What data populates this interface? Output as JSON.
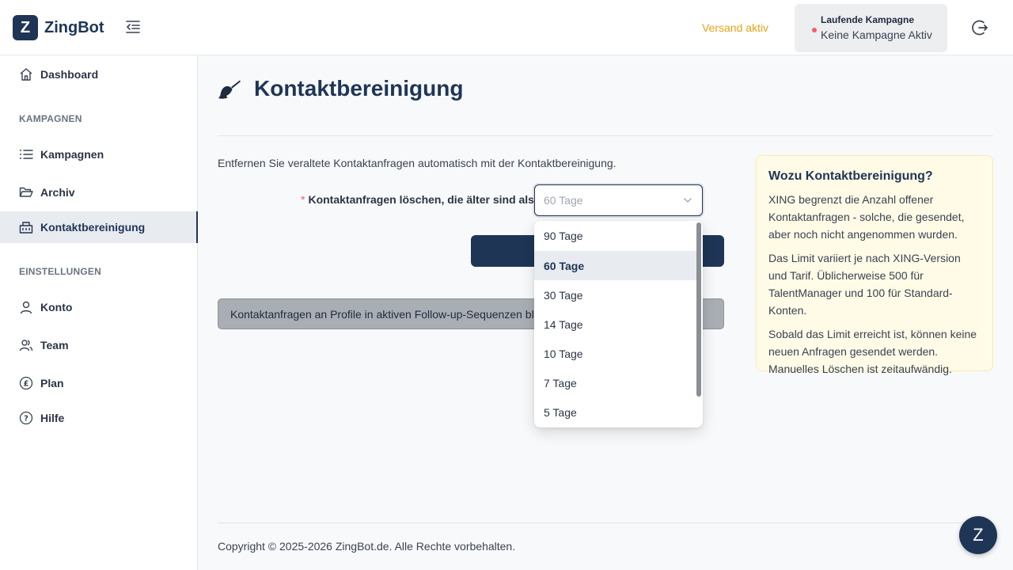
{
  "header": {
    "logo_letter": "Z",
    "app_name": "ZingBot",
    "versand_status": "Versand aktiv",
    "campaign_label": "Laufende Kampagne",
    "campaign_value": "Keine Kampagne Aktiv",
    "accent_color": "#e6a417",
    "status_dot_color": "#f45c6b"
  },
  "sidebar": {
    "dashboard": "Dashboard",
    "section_campaigns": "KAMPAGNEN",
    "kampagnen": "Kampagnen",
    "archiv": "Archiv",
    "kontaktbereinigung": "Kontaktbereinigung",
    "section_settings": "EINSTELLUNGEN",
    "konto": "Konto",
    "team": "Team",
    "plan": "Plan",
    "hilfe": "Hilfe",
    "active_item": "Kontaktbereinigung"
  },
  "main": {
    "title": "Kontaktbereinigung",
    "title_icon": "broom-icon",
    "intro": "Entfernen Sie veraltete Kontaktanfragen automatisch mit der Kontaktbereinigung.",
    "form_required_mark": "*",
    "form_label": "Kontaktanfragen löschen, die älter sind als :",
    "select_value": "60 Tage",
    "gray_bar_text": "Kontaktanfragen an Profile in aktiven Follow-up-Sequenzen bleiben erhalten"
  },
  "dropdown": {
    "options": [
      "90 Tage",
      "60 Tage",
      "30 Tage",
      "14 Tage",
      "10 Tage",
      "7 Tage",
      "5 Tage"
    ],
    "selected": "60 Tage"
  },
  "info": {
    "title": "Wozu Kontaktbereinigung?",
    "p1": "XING begrenzt die Anzahl offener Kontaktanfragen - solche, die gesendet, aber noch nicht angenommen wurden.",
    "p2": "Das Limit variiert je nach XING-Version und Tarif. Üblicherweise 500 für TalentManager und 100 für Standard-Konten.",
    "p3": "Sobald das Limit erreicht ist, können keine neuen Anfragen gesendet werden. Manuelles Löschen ist zeitaufwändig."
  },
  "footer": {
    "text": "Copyright © 2025-2026 ZingBot.de. Alle Rechte vorbehalten.",
    "chat_letter": "Z"
  }
}
